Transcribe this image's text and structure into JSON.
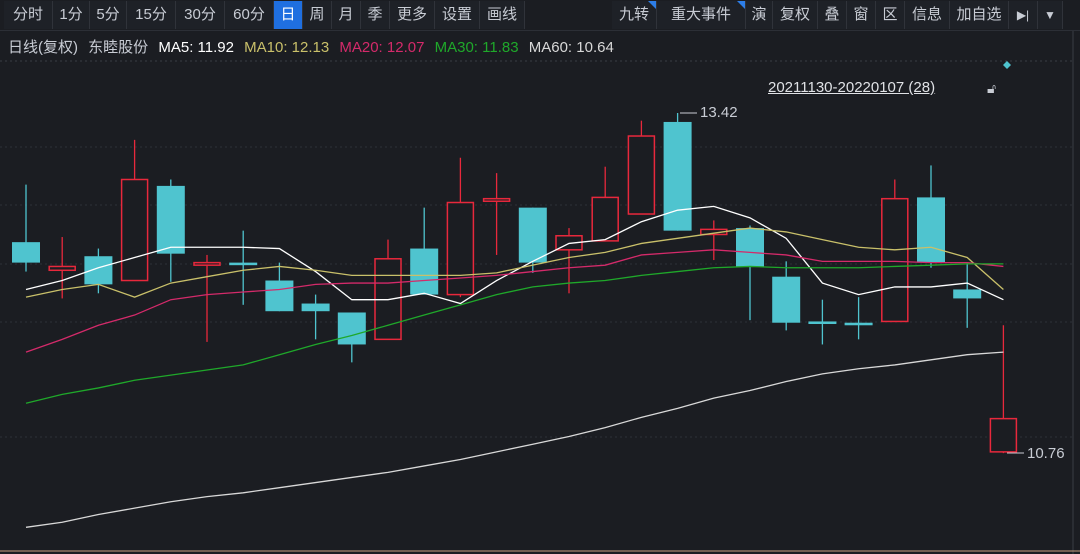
{
  "toolbar": {
    "left": [
      "分时",
      "1分",
      "5分",
      "15分",
      "30分",
      "60分",
      "日",
      "周",
      "月",
      "季",
      "更多",
      "设置",
      "画线"
    ],
    "active": "日",
    "right": [
      "九转",
      "重大事件",
      "演",
      "复权",
      "叠",
      "窗",
      "区",
      "信息",
      "加自选"
    ],
    "flagged": [
      "九转",
      "重大事件"
    ],
    "icons": [
      "collapse-right-icon",
      "dropdown-icon"
    ]
  },
  "info": {
    "period": "日线(复权)",
    "stock": "东睦股份",
    "ma5": "MA5: 11.92",
    "ma10": "MA10: 12.13",
    "ma20": "MA20: 12.07",
    "ma30": "MA30: 11.83",
    "ma60": "MA60: 10.64"
  },
  "range_label": "20211130-20220107 (28)",
  "colors": {
    "up": "#e8283c",
    "down": "#4fc4cf",
    "ma5": "#ffffff",
    "ma10": "#c9c06a",
    "ma20": "#d42a6a",
    "ma30": "#1fa82a",
    "ma60": "#d8d8d8"
  },
  "chart_data": {
    "type": "candlestick",
    "high_label": "13.42",
    "low_label": "10.76",
    "ylim": [
      10.0,
      13.9
    ],
    "candles": [
      [
        12.41,
        12.25,
        12.86,
        12.18
      ],
      [
        12.19,
        12.22,
        12.45,
        11.97
      ],
      [
        12.3,
        12.08,
        12.36,
        12.01
      ],
      [
        12.11,
        12.9,
        13.21,
        12.11
      ],
      [
        12.85,
        12.32,
        12.9,
        12.1
      ],
      [
        12.23,
        12.25,
        12.31,
        11.63
      ],
      [
        12.25,
        12.23,
        12.5,
        11.92
      ],
      [
        12.11,
        11.87,
        12.25,
        11.87
      ],
      [
        11.93,
        11.87,
        12.0,
        11.65
      ],
      [
        11.86,
        11.61,
        11.86,
        11.47
      ],
      [
        11.65,
        12.28,
        12.43,
        11.65
      ],
      [
        12.36,
        12.0,
        12.68,
        12.0
      ],
      [
        12.0,
        12.72,
        13.07,
        11.98
      ],
      [
        12.73,
        12.75,
        12.95,
        12.31
      ],
      [
        12.68,
        12.25,
        12.68,
        12.17
      ],
      [
        12.35,
        12.46,
        12.52,
        12.01
      ],
      [
        12.42,
        12.76,
        13.0,
        12.42
      ],
      [
        12.63,
        13.24,
        13.36,
        12.63
      ],
      [
        13.35,
        12.5,
        13.42,
        12.5
      ],
      [
        12.47,
        12.51,
        12.58,
        12.27
      ],
      [
        12.52,
        12.22,
        12.54,
        11.8
      ],
      [
        12.14,
        11.78,
        12.26,
        11.72
      ],
      [
        11.79,
        11.77,
        11.96,
        11.61
      ],
      [
        11.78,
        11.76,
        11.98,
        11.65
      ],
      [
        11.79,
        12.75,
        12.9,
        11.79
      ],
      [
        12.76,
        12.25,
        13.01,
        12.21
      ],
      [
        12.04,
        11.97,
        12.25,
        11.74
      ],
      [
        10.77,
        11.03,
        11.76,
        10.76
      ]
    ],
    "series": [
      {
        "name": "MA5",
        "values": [
          12.04,
          12.11,
          12.21,
          12.29,
          12.37,
          12.37,
          12.37,
          12.36,
          12.18,
          11.96,
          11.96,
          12.01,
          11.93,
          12.11,
          12.26,
          12.4,
          12.43,
          12.57,
          12.66,
          12.69,
          12.6,
          12.44,
          12.09,
          12.0,
          12.06,
          12.06,
          12.09,
          11.96
        ]
      },
      {
        "name": "MA10",
        "values": [
          11.98,
          12.04,
          12.08,
          11.98,
          12.09,
          12.14,
          12.19,
          12.22,
          12.19,
          12.15,
          12.15,
          12.15,
          12.15,
          12.17,
          12.23,
          12.29,
          12.33,
          12.4,
          12.44,
          12.48,
          12.52,
          12.49,
          12.43,
          12.37,
          12.35,
          12.37,
          12.29,
          12.04
        ]
      },
      {
        "name": "MA20",
        "values": [
          11.55,
          11.65,
          11.76,
          11.84,
          11.96,
          12.0,
          12.02,
          12.04,
          12.08,
          12.09,
          12.09,
          12.11,
          12.13,
          12.15,
          12.18,
          12.21,
          12.23,
          12.31,
          12.33,
          12.35,
          12.33,
          12.31,
          12.26,
          12.26,
          12.26,
          12.25,
          12.25,
          12.22
        ]
      },
      {
        "name": "MA30",
        "values": [
          11.15,
          11.22,
          11.27,
          11.33,
          11.37,
          11.41,
          11.45,
          11.53,
          11.61,
          11.68,
          11.76,
          11.84,
          11.92,
          12.0,
          12.06,
          12.09,
          12.11,
          12.15,
          12.18,
          12.21,
          12.22,
          12.21,
          12.21,
          12.21,
          12.22,
          12.23,
          12.24,
          12.24
        ]
      },
      {
        "name": "MA60",
        "values": [
          10.18,
          10.22,
          10.28,
          10.33,
          10.38,
          10.42,
          10.45,
          10.49,
          10.53,
          10.57,
          10.61,
          10.66,
          10.71,
          10.77,
          10.83,
          10.89,
          10.96,
          11.04,
          11.11,
          11.19,
          11.25,
          11.32,
          11.38,
          11.42,
          11.45,
          11.49,
          11.53,
          11.55
        ]
      }
    ]
  }
}
